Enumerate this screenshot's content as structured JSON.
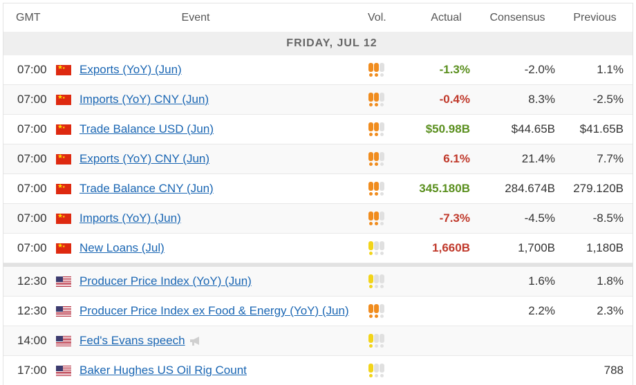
{
  "headers": {
    "time": "GMT",
    "event": "Event",
    "vol": "Vol.",
    "actual": "Actual",
    "consensus": "Consensus",
    "previous": "Previous"
  },
  "day_label": "FRIDAY, JUL 12",
  "colors": {
    "positive": "#5a8f1e",
    "negative": "#c0392b",
    "link": "#1a66b3",
    "volatility_high": "#f08c1e",
    "volatility_low": "#f2d41a",
    "volatility_off": "#e0e0e0"
  },
  "rows": [
    {
      "time": "07:00",
      "country": "china-flag-icon",
      "event": "Exports (YoY) (Jun)",
      "volatility": 2,
      "actual": "-1.3%",
      "actual_dir": "positive",
      "consensus": "-2.0%",
      "previous": "1.1%"
    },
    {
      "time": "07:00",
      "country": "china-flag-icon",
      "event": "Imports (YoY) CNY (Jun)",
      "volatility": 2,
      "actual": "-0.4%",
      "actual_dir": "negative",
      "consensus": "8.3%",
      "previous": "-2.5%"
    },
    {
      "time": "07:00",
      "country": "china-flag-icon",
      "event": "Trade Balance USD (Jun)",
      "volatility": 2,
      "actual": "$50.98B",
      "actual_dir": "positive",
      "consensus": "$44.65B",
      "previous": "$41.65B"
    },
    {
      "time": "07:00",
      "country": "china-flag-icon",
      "event": "Exports (YoY) CNY (Jun)",
      "volatility": 2,
      "actual": "6.1%",
      "actual_dir": "negative",
      "consensus": "21.4%",
      "previous": "7.7%"
    },
    {
      "time": "07:00",
      "country": "china-flag-icon",
      "event": "Trade Balance CNY (Jun)",
      "volatility": 2,
      "actual": "345.180B",
      "actual_dir": "positive",
      "consensus": "284.674B",
      "previous": "279.120B"
    },
    {
      "time": "07:00",
      "country": "china-flag-icon",
      "event": "Imports (YoY) (Jun)",
      "volatility": 2,
      "actual": "-7.3%",
      "actual_dir": "negative",
      "consensus": "-4.5%",
      "previous": "-8.5%"
    },
    {
      "time": "07:00",
      "country": "china-flag-icon",
      "event": "New Loans (Jul)",
      "volatility": 1,
      "actual": "1,660B",
      "actual_dir": "negative",
      "consensus": "1,700B",
      "previous": "1,180B"
    },
    {
      "time": "12:30",
      "country": "usa-flag-icon",
      "event": "Producer Price Index (YoY) (Jun)",
      "volatility": 1,
      "actual": "",
      "actual_dir": "",
      "consensus": "1.6%",
      "previous": "1.8%"
    },
    {
      "time": "12:30",
      "country": "usa-flag-icon",
      "event": "Producer Price Index ex Food & Energy (YoY) (Jun)",
      "volatility": 2,
      "actual": "",
      "actual_dir": "",
      "consensus": "2.2%",
      "previous": "2.3%"
    },
    {
      "time": "14:00",
      "country": "usa-flag-icon",
      "event": "Fed's Evans speech",
      "volatility": 1,
      "speech": true,
      "actual": "",
      "actual_dir": "",
      "consensus": "",
      "previous": ""
    },
    {
      "time": "17:00",
      "country": "usa-flag-icon",
      "event": "Baker Hughes US Oil Rig Count",
      "volatility": 1,
      "actual": "",
      "actual_dir": "",
      "consensus": "",
      "previous": "788"
    }
  ]
}
